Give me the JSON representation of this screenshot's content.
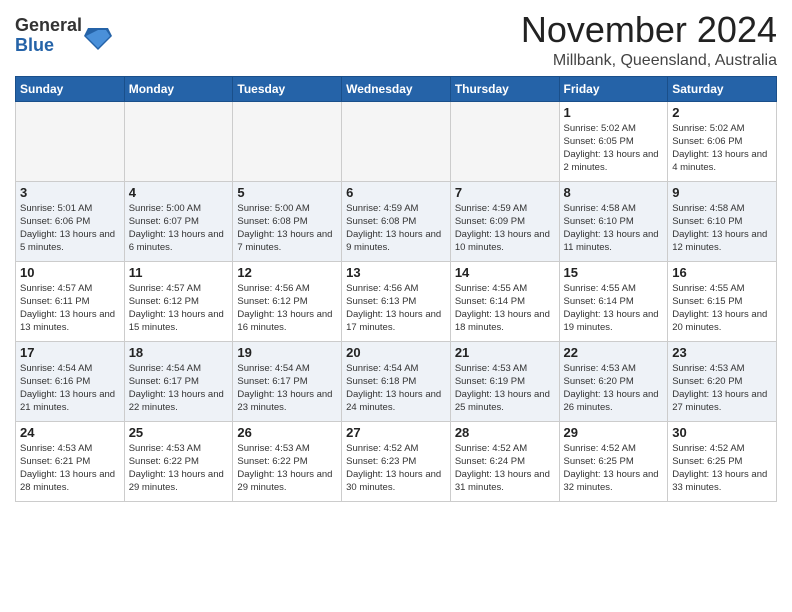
{
  "header": {
    "logo_general": "General",
    "logo_blue": "Blue",
    "month_title": "November 2024",
    "location": "Millbank, Queensland, Australia"
  },
  "days_of_week": [
    "Sunday",
    "Monday",
    "Tuesday",
    "Wednesday",
    "Thursday",
    "Friday",
    "Saturday"
  ],
  "weeks": [
    [
      {
        "day": "",
        "info": ""
      },
      {
        "day": "",
        "info": ""
      },
      {
        "day": "",
        "info": ""
      },
      {
        "day": "",
        "info": ""
      },
      {
        "day": "",
        "info": ""
      },
      {
        "day": "1",
        "info": "Sunrise: 5:02 AM\nSunset: 6:05 PM\nDaylight: 13 hours and 2 minutes."
      },
      {
        "day": "2",
        "info": "Sunrise: 5:02 AM\nSunset: 6:06 PM\nDaylight: 13 hours and 4 minutes."
      }
    ],
    [
      {
        "day": "3",
        "info": "Sunrise: 5:01 AM\nSunset: 6:06 PM\nDaylight: 13 hours and 5 minutes."
      },
      {
        "day": "4",
        "info": "Sunrise: 5:00 AM\nSunset: 6:07 PM\nDaylight: 13 hours and 6 minutes."
      },
      {
        "day": "5",
        "info": "Sunrise: 5:00 AM\nSunset: 6:08 PM\nDaylight: 13 hours and 7 minutes."
      },
      {
        "day": "6",
        "info": "Sunrise: 4:59 AM\nSunset: 6:08 PM\nDaylight: 13 hours and 9 minutes."
      },
      {
        "day": "7",
        "info": "Sunrise: 4:59 AM\nSunset: 6:09 PM\nDaylight: 13 hours and 10 minutes."
      },
      {
        "day": "8",
        "info": "Sunrise: 4:58 AM\nSunset: 6:10 PM\nDaylight: 13 hours and 11 minutes."
      },
      {
        "day": "9",
        "info": "Sunrise: 4:58 AM\nSunset: 6:10 PM\nDaylight: 13 hours and 12 minutes."
      }
    ],
    [
      {
        "day": "10",
        "info": "Sunrise: 4:57 AM\nSunset: 6:11 PM\nDaylight: 13 hours and 13 minutes."
      },
      {
        "day": "11",
        "info": "Sunrise: 4:57 AM\nSunset: 6:12 PM\nDaylight: 13 hours and 15 minutes."
      },
      {
        "day": "12",
        "info": "Sunrise: 4:56 AM\nSunset: 6:12 PM\nDaylight: 13 hours and 16 minutes."
      },
      {
        "day": "13",
        "info": "Sunrise: 4:56 AM\nSunset: 6:13 PM\nDaylight: 13 hours and 17 minutes."
      },
      {
        "day": "14",
        "info": "Sunrise: 4:55 AM\nSunset: 6:14 PM\nDaylight: 13 hours and 18 minutes."
      },
      {
        "day": "15",
        "info": "Sunrise: 4:55 AM\nSunset: 6:14 PM\nDaylight: 13 hours and 19 minutes."
      },
      {
        "day": "16",
        "info": "Sunrise: 4:55 AM\nSunset: 6:15 PM\nDaylight: 13 hours and 20 minutes."
      }
    ],
    [
      {
        "day": "17",
        "info": "Sunrise: 4:54 AM\nSunset: 6:16 PM\nDaylight: 13 hours and 21 minutes."
      },
      {
        "day": "18",
        "info": "Sunrise: 4:54 AM\nSunset: 6:17 PM\nDaylight: 13 hours and 22 minutes."
      },
      {
        "day": "19",
        "info": "Sunrise: 4:54 AM\nSunset: 6:17 PM\nDaylight: 13 hours and 23 minutes."
      },
      {
        "day": "20",
        "info": "Sunrise: 4:54 AM\nSunset: 6:18 PM\nDaylight: 13 hours and 24 minutes."
      },
      {
        "day": "21",
        "info": "Sunrise: 4:53 AM\nSunset: 6:19 PM\nDaylight: 13 hours and 25 minutes."
      },
      {
        "day": "22",
        "info": "Sunrise: 4:53 AM\nSunset: 6:20 PM\nDaylight: 13 hours and 26 minutes."
      },
      {
        "day": "23",
        "info": "Sunrise: 4:53 AM\nSunset: 6:20 PM\nDaylight: 13 hours and 27 minutes."
      }
    ],
    [
      {
        "day": "24",
        "info": "Sunrise: 4:53 AM\nSunset: 6:21 PM\nDaylight: 13 hours and 28 minutes."
      },
      {
        "day": "25",
        "info": "Sunrise: 4:53 AM\nSunset: 6:22 PM\nDaylight: 13 hours and 29 minutes."
      },
      {
        "day": "26",
        "info": "Sunrise: 4:53 AM\nSunset: 6:22 PM\nDaylight: 13 hours and 29 minutes."
      },
      {
        "day": "27",
        "info": "Sunrise: 4:52 AM\nSunset: 6:23 PM\nDaylight: 13 hours and 30 minutes."
      },
      {
        "day": "28",
        "info": "Sunrise: 4:52 AM\nSunset: 6:24 PM\nDaylight: 13 hours and 31 minutes."
      },
      {
        "day": "29",
        "info": "Sunrise: 4:52 AM\nSunset: 6:25 PM\nDaylight: 13 hours and 32 minutes."
      },
      {
        "day": "30",
        "info": "Sunrise: 4:52 AM\nSunset: 6:25 PM\nDaylight: 13 hours and 33 minutes."
      }
    ]
  ]
}
